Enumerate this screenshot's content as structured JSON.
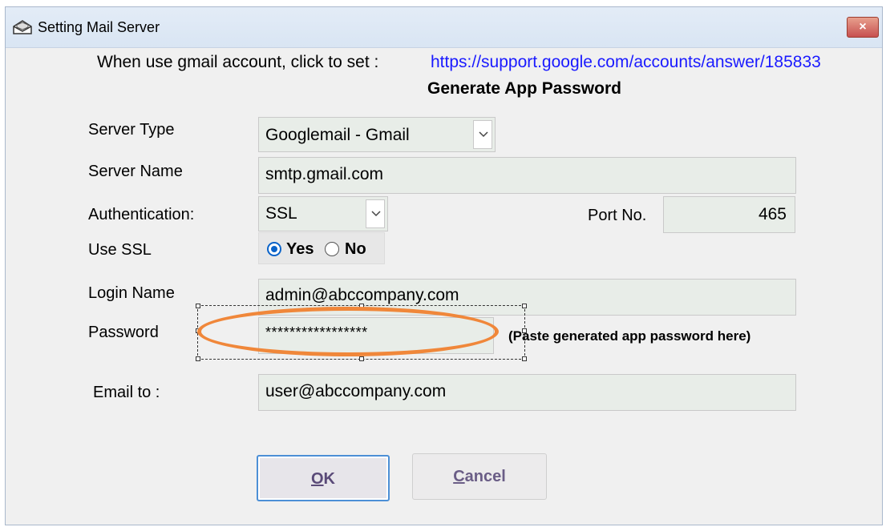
{
  "window": {
    "title": "Setting Mail Server",
    "close_symbol": "×"
  },
  "header": {
    "gmail_prompt": "When use gmail account, click to set :",
    "gmail_link": "https://support.google.com/accounts/answer/185833",
    "generate_label": "Generate App Password"
  },
  "form": {
    "server_type": {
      "label": "Server Type",
      "value": "Googlemail - Gmail"
    },
    "server_name": {
      "label": "Server Name",
      "value": "smtp.gmail.com"
    },
    "authentication": {
      "label": "Authentication:",
      "value": "SSL"
    },
    "port": {
      "label": "Port No.",
      "value": "465"
    },
    "use_ssl": {
      "label": "Use SSL",
      "yes_label": "Yes",
      "no_label": "No",
      "selected": "Yes"
    },
    "login_name": {
      "label": "Login Name",
      "value": "admin@abccompany.com"
    },
    "password": {
      "label": "Password",
      "value": "*****************",
      "hint": "(Paste generated app password here)"
    },
    "email_to": {
      "label": "Email to :",
      "value": "user@abccompany.com"
    }
  },
  "buttons": {
    "ok_mnemonic": "O",
    "ok_rest": "K",
    "cancel_mnemonic": "C",
    "cancel_rest": "ancel"
  },
  "colors": {
    "link": "#1a1aff",
    "highlight_ellipse": "#f0873a",
    "radio_selected": "#0a63c9"
  },
  "icons": {
    "app_icon": "mail-envelope-icon",
    "close": "close-icon",
    "dropdown": "chevron-down-icon"
  }
}
